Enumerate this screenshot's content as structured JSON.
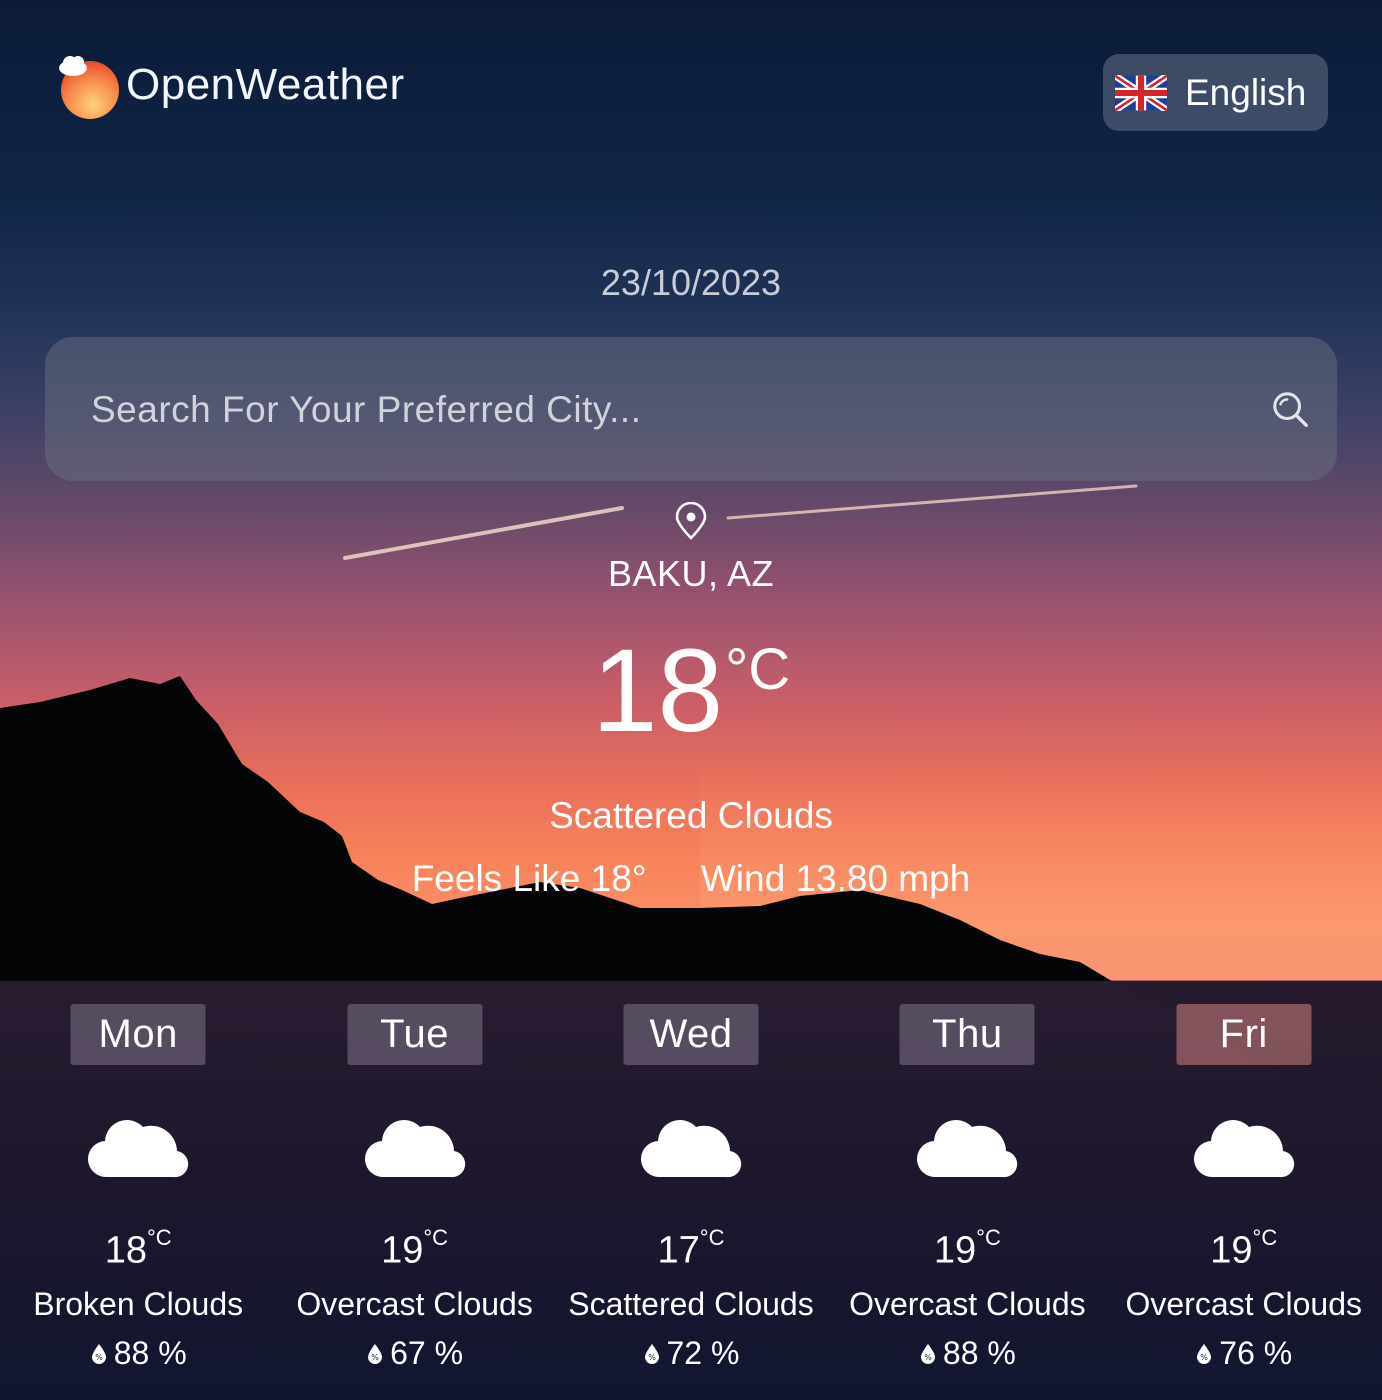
{
  "app": {
    "logo_text": "OpenWeather"
  },
  "language": {
    "label": "English",
    "flag_icon": "uk-flag-icon"
  },
  "date": "23/10/2023",
  "search": {
    "placeholder": "Search For Your Preferred City...",
    "value": "",
    "icon": "search-icon"
  },
  "current": {
    "location": "BAKU, AZ",
    "temperature": "18",
    "unit": "°C",
    "condition": "Scattered Clouds",
    "feels_like": "Feels Like 18°",
    "wind": "Wind 13.80 mph"
  },
  "forecast": [
    {
      "day": "Mon",
      "temp": "18",
      "unit": "°C",
      "condition": "Broken Clouds",
      "humidity": "88 %",
      "icon": "cloud-icon"
    },
    {
      "day": "Tue",
      "temp": "19",
      "unit": "°C",
      "condition": "Overcast Clouds",
      "humidity": "67 %",
      "icon": "cloud-icon"
    },
    {
      "day": "Wed",
      "temp": "17",
      "unit": "°C",
      "condition": "Scattered Clouds",
      "humidity": "72 %",
      "icon": "cloud-icon"
    },
    {
      "day": "Thu",
      "temp": "19",
      "unit": "°C",
      "condition": "Overcast Clouds",
      "humidity": "88 %",
      "icon": "cloud-icon"
    },
    {
      "day": "Fri",
      "temp": "19",
      "unit": "°C",
      "condition": "Overcast Clouds",
      "humidity": "76 %",
      "icon": "cloud-icon"
    }
  ],
  "colors": {
    "sky_top": "#0b1b37",
    "sunset_orange": "#f7815a",
    "mountain": "#050507",
    "forecast_panel": "#1c1a30"
  }
}
